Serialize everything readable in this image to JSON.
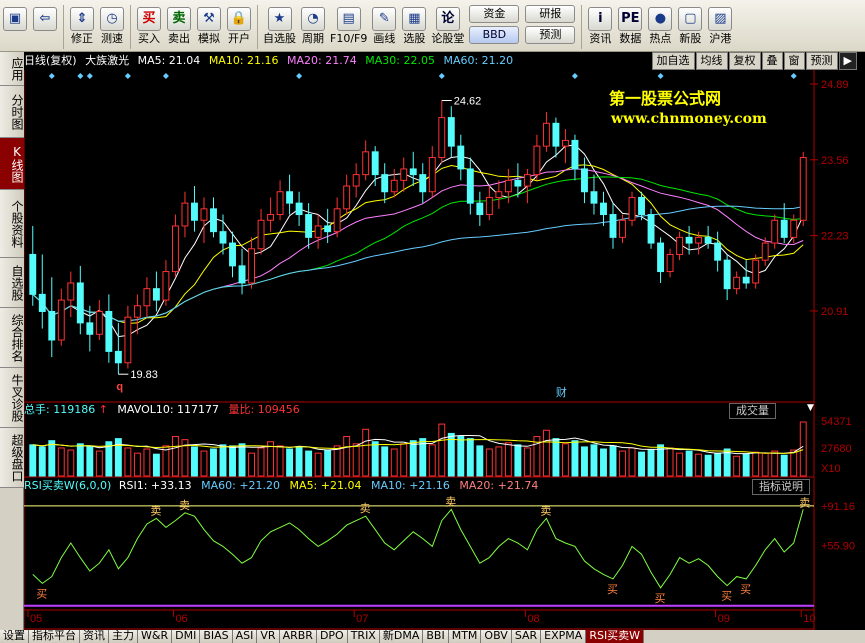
{
  "toolbar": {
    "items": [
      {
        "label": "",
        "icon": "zoom-box-icon"
      },
      {
        "label": "",
        "icon": "back-arrow-icon"
      },
      {
        "label": "修正",
        "icon": "up-down-arrows-icon"
      },
      {
        "label": "测速",
        "icon": "clock-icon"
      },
      {
        "label": "买入",
        "glyph": "买"
      },
      {
        "label": "卖出",
        "glyph": "卖"
      },
      {
        "label": "模拟",
        "icon": "hammer-icon"
      },
      {
        "label": "开户",
        "icon": "lock-icon"
      },
      {
        "label": "自选股",
        "icon": "star-icon"
      },
      {
        "label": "周期",
        "icon": "period-icon"
      },
      {
        "label": "F10/F9",
        "icon": "f10-icon"
      },
      {
        "label": "画线",
        "icon": "pen-icon"
      },
      {
        "label": "选股",
        "icon": "stock-select-icon"
      },
      {
        "label": "论股堂",
        "glyph": "论"
      },
      {
        "label": "资讯",
        "glyph": "i"
      },
      {
        "label": "数据",
        "glyph": "PE"
      },
      {
        "label": "热点",
        "icon": "hot-icon"
      },
      {
        "label": "新股",
        "icon": "new-stock-icon"
      },
      {
        "label": "沪港",
        "icon": "hk-icon"
      }
    ],
    "pills": [
      "资金",
      "BBD",
      "研报",
      "预测"
    ]
  },
  "leftnav": [
    "应用",
    "分时图",
    "K线图",
    "个股资料",
    "自选股",
    "综合排名",
    "牛叉诊股",
    "超级盘口"
  ],
  "leftnav_active": 2,
  "infobar": {
    "title": "日线(复权)",
    "stock": "大族激光",
    "ma5": "MA5: 21.04",
    "ma10": "MA10: 21.16",
    "ma20": "MA20: 21.74",
    "ma30": "MA30: 22.05",
    "ma60": "MA60: 21.20",
    "buttons": [
      "加自选",
      "均线",
      "复权",
      "叠",
      "窗",
      "预测"
    ]
  },
  "colors": {
    "up": "#ff3232",
    "down": "#54fcfc",
    "ma5": "#ffffff",
    "ma10": "#ffff00",
    "ma20": "#ff80ff",
    "ma30": "#00e600",
    "ma60": "#66ccff",
    "axis": "#b00000",
    "watermark": "#ffff00"
  },
  "watermark": {
    "line1": "第一股票公式网",
    "line2": "www.chnmoney.com"
  },
  "price_axis": [
    "24.89",
    "23.56",
    "22.23",
    "20.91"
  ],
  "annotations": {
    "high": "24.62",
    "low": "19.83",
    "q_marker": "q",
    "cai_marker": "财"
  },
  "volume": {
    "label1": "总手: 119186",
    "label2": "MAVOL10: 117177",
    "label3": "量比: 109456",
    "button": "成交量",
    "axis": [
      "54371",
      "27680",
      "X10"
    ]
  },
  "indicator": {
    "name": "RSI买卖W(6,0,0)",
    "rsi1": "RSI1: +33.13",
    "ma60": "MA60: +21.20",
    "ma5": "MA5: +21.04",
    "ma10": "MA10: +21.16",
    "ma20": "MA20: +21.74",
    "button": "指标说明",
    "axis": [
      "+91.16",
      "+55.90"
    ],
    "sell": "卖",
    "buy": "买"
  },
  "months": [
    "05",
    "06",
    "07",
    "08",
    "09",
    "10"
  ],
  "bottom_tabs": [
    "设置",
    "指标平台",
    "资讯",
    "主力",
    "W&R",
    "DMI",
    "BIAS",
    "ASI",
    "VR",
    "ARBR",
    "DPO",
    "TRIX",
    "新DMA",
    "BBI",
    "MTM",
    "OBV",
    "SAR",
    "EXPMA",
    "RSI买卖W"
  ],
  "bottom_active": 18,
  "chart_data": {
    "type": "candlestick",
    "ylim": [
      19.4,
      25.1
    ],
    "candles": [
      [
        21.9,
        22.4,
        21.0,
        21.2
      ],
      [
        21.2,
        21.9,
        20.6,
        20.9
      ],
      [
        20.9,
        21.5,
        20.1,
        20.4
      ],
      [
        20.4,
        21.3,
        20.3,
        21.1
      ],
      [
        21.1,
        21.6,
        20.8,
        21.4
      ],
      [
        21.4,
        21.7,
        20.5,
        20.7
      ],
      [
        20.7,
        21.0,
        20.2,
        20.5
      ],
      [
        20.5,
        21.1,
        20.4,
        20.9
      ],
      [
        20.9,
        21.2,
        20.0,
        20.2
      ],
      [
        20.2,
        20.7,
        19.8,
        20.0
      ],
      [
        20.0,
        21.0,
        19.9,
        20.8
      ],
      [
        20.8,
        21.2,
        20.5,
        21.0
      ],
      [
        21.0,
        21.5,
        20.8,
        21.3
      ],
      [
        21.3,
        21.6,
        20.9,
        21.1
      ],
      [
        21.1,
        21.8,
        21.0,
        21.6
      ],
      [
        21.6,
        22.6,
        21.5,
        22.4
      ],
      [
        22.4,
        23.0,
        22.2,
        22.8
      ],
      [
        22.8,
        23.1,
        22.3,
        22.5
      ],
      [
        22.5,
        22.9,
        22.1,
        22.7
      ],
      [
        22.7,
        22.9,
        22.2,
        22.3
      ],
      [
        22.3,
        22.6,
        21.9,
        22.1
      ],
      [
        22.1,
        22.3,
        21.5,
        21.7
      ],
      [
        21.7,
        22.0,
        21.2,
        21.4
      ],
      [
        21.4,
        22.2,
        21.3,
        22.0
      ],
      [
        22.0,
        22.7,
        21.9,
        22.5
      ],
      [
        22.5,
        22.9,
        22.3,
        22.6
      ],
      [
        22.6,
        23.2,
        22.5,
        23.0
      ],
      [
        23.0,
        23.3,
        22.6,
        22.8
      ],
      [
        22.8,
        23.0,
        22.4,
        22.6
      ],
      [
        22.6,
        22.8,
        22.0,
        22.2
      ],
      [
        22.2,
        22.6,
        22.0,
        22.4
      ],
      [
        22.4,
        22.7,
        22.1,
        22.3
      ],
      [
        22.3,
        22.9,
        22.2,
        22.7
      ],
      [
        22.7,
        23.3,
        22.6,
        23.1
      ],
      [
        23.1,
        23.5,
        22.9,
        23.3
      ],
      [
        23.3,
        23.9,
        23.2,
        23.7
      ],
      [
        23.7,
        23.8,
        23.1,
        23.3
      ],
      [
        23.3,
        23.5,
        22.8,
        23.0
      ],
      [
        23.0,
        23.4,
        22.9,
        23.2
      ],
      [
        23.2,
        23.6,
        23.0,
        23.4
      ],
      [
        23.4,
        23.7,
        23.1,
        23.3
      ],
      [
        23.3,
        23.5,
        22.8,
        23.0
      ],
      [
        23.0,
        23.8,
        22.9,
        23.6
      ],
      [
        23.6,
        24.6,
        23.5,
        24.3
      ],
      [
        24.3,
        24.5,
        23.6,
        23.8
      ],
      [
        23.8,
        24.0,
        23.2,
        23.4
      ],
      [
        23.4,
        23.6,
        22.6,
        22.8
      ],
      [
        22.8,
        23.0,
        22.4,
        22.6
      ],
      [
        22.6,
        23.1,
        22.5,
        22.9
      ],
      [
        22.9,
        23.2,
        22.7,
        23.0
      ],
      [
        23.0,
        23.4,
        22.8,
        23.2
      ],
      [
        23.2,
        23.5,
        22.9,
        23.1
      ],
      [
        23.1,
        23.4,
        22.8,
        23.3
      ],
      [
        23.3,
        24.0,
        23.2,
        23.8
      ],
      [
        23.8,
        24.4,
        23.7,
        24.2
      ],
      [
        24.2,
        24.3,
        23.6,
        23.8
      ],
      [
        23.8,
        24.1,
        23.5,
        23.9
      ],
      [
        23.9,
        24.0,
        23.2,
        23.4
      ],
      [
        23.4,
        23.6,
        22.8,
        23.0
      ],
      [
        23.0,
        23.3,
        22.6,
        22.8
      ],
      [
        22.8,
        23.0,
        22.4,
        22.6
      ],
      [
        22.6,
        22.8,
        22.0,
        22.2
      ],
      [
        22.2,
        22.6,
        22.1,
        22.5
      ],
      [
        22.5,
        23.0,
        22.4,
        22.9
      ],
      [
        22.9,
        23.0,
        22.5,
        22.6
      ],
      [
        22.6,
        22.7,
        22.0,
        22.1
      ],
      [
        22.1,
        22.2,
        21.4,
        21.6
      ],
      [
        21.6,
        22.0,
        21.5,
        21.9
      ],
      [
        21.9,
        22.3,
        21.8,
        22.2
      ],
      [
        22.2,
        22.4,
        21.9,
        22.1
      ],
      [
        22.1,
        22.3,
        21.9,
        22.2
      ],
      [
        22.2,
        22.4,
        22.0,
        22.1
      ],
      [
        22.1,
        22.3,
        21.6,
        21.8
      ],
      [
        21.8,
        21.9,
        21.1,
        21.3
      ],
      [
        21.3,
        21.6,
        21.2,
        21.5
      ],
      [
        21.5,
        21.8,
        21.3,
        21.4
      ],
      [
        21.4,
        21.9,
        21.3,
        21.8
      ],
      [
        21.8,
        22.2,
        21.7,
        22.1
      ],
      [
        22.1,
        22.6,
        22.0,
        22.5
      ],
      [
        22.5,
        22.8,
        22.1,
        22.2
      ],
      [
        22.2,
        22.6,
        22.1,
        22.5
      ],
      [
        22.5,
        23.7,
        22.4,
        23.6
      ]
    ],
    "volume": [
      30,
      28,
      34,
      27,
      25,
      31,
      29,
      24,
      33,
      36,
      27,
      22,
      26,
      21,
      29,
      38,
      35,
      28,
      24,
      26,
      30,
      29,
      31,
      22,
      27,
      33,
      29,
      26,
      28,
      24,
      22,
      25,
      29,
      38,
      31,
      45,
      33,
      28,
      26,
      31,
      34,
      36,
      30,
      50,
      41,
      38,
      36,
      29,
      26,
      28,
      32,
      30,
      27,
      38,
      44,
      36,
      31,
      34,
      28,
      30,
      26,
      29,
      24,
      27,
      23,
      25,
      30,
      27,
      22,
      24,
      21,
      20,
      22,
      26,
      19,
      21,
      23,
      22,
      24,
      20,
      25,
      52
    ],
    "rsi": [
      30,
      22,
      28,
      45,
      58,
      45,
      33,
      40,
      52,
      35,
      45,
      62,
      75,
      80,
      72,
      78,
      85,
      82,
      70,
      60,
      55,
      48,
      40,
      45,
      60,
      68,
      72,
      76,
      70,
      62,
      55,
      60,
      66,
      74,
      78,
      82,
      70,
      58,
      52,
      60,
      68,
      62,
      55,
      78,
      88,
      70,
      55,
      40,
      45,
      55,
      62,
      58,
      52,
      70,
      80,
      62,
      58,
      55,
      42,
      35,
      30,
      26,
      38,
      55,
      48,
      32,
      18,
      30,
      45,
      40,
      44,
      38,
      28,
      20,
      28,
      26,
      38,
      52,
      62,
      50,
      58,
      88
    ]
  }
}
